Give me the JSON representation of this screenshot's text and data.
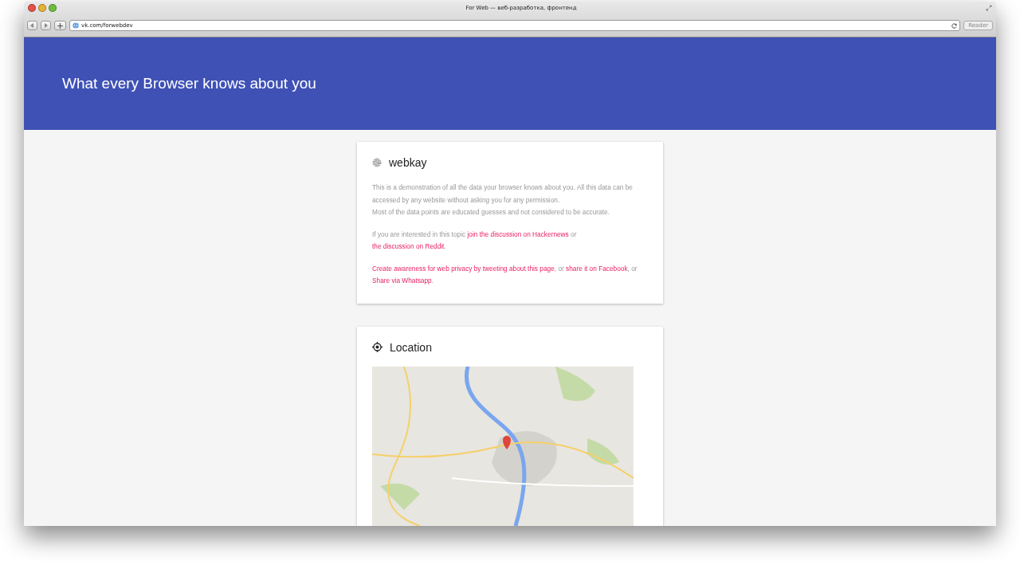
{
  "window": {
    "title": "For Web — веб-разработка, фронтенд",
    "address": "vk.com/forwebdev",
    "reader_button": "Reader"
  },
  "header": {
    "title": "What every Browser knows about you"
  },
  "intro_card": {
    "title": "webkay",
    "paragraphs": [
      [
        {
          "kind": "text",
          "text": "This is a demonstration of all the data your browser knows about you. All this data can be accessed by any website without asking you for any permission."
        }
      ],
      [
        {
          "kind": "text",
          "text": "Most of the data points are educated guesses and not considered to be accurate."
        }
      ],
      [
        {
          "kind": "text",
          "text": "If you are interested in this topic"
        },
        {
          "kind": "link",
          "text": "join the discussion on Hackernews"
        },
        {
          "kind": "text",
          "text": "or"
        },
        {
          "kind": "link",
          "text": "the discussion on Reddit"
        },
        {
          "kind": "text",
          "text": "."
        }
      ],
      [
        {
          "kind": "link",
          "text": "Create awareness for web privacy by tweeting about this page"
        },
        {
          "kind": "text",
          "text": ", or"
        },
        {
          "kind": "link",
          "text": "share it on Facebook"
        },
        {
          "kind": "text",
          "text": ", or"
        },
        {
          "kind": "link",
          "text": "Share via Whatsapp"
        },
        {
          "kind": "text",
          "text": "."
        }
      ]
    ]
  },
  "location_card": {
    "title": "Location"
  }
}
